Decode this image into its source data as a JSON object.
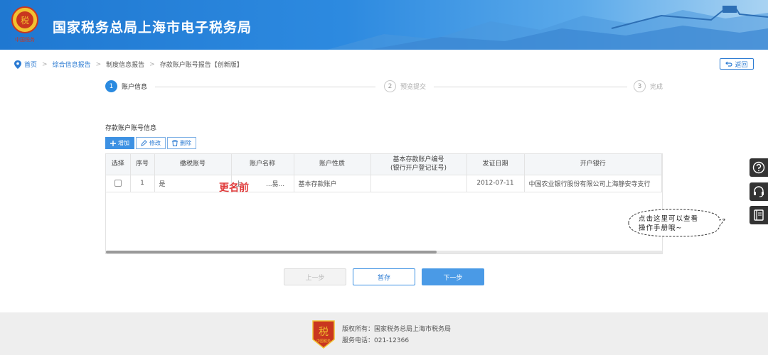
{
  "header": {
    "title": "国家税务总局上海市电子税务局",
    "logo_caption": "中国税务"
  },
  "breadcrumb": {
    "items": [
      "首页",
      "综合信息报告",
      "制度信息报告",
      "存款账户账号报告【创新版】"
    ]
  },
  "back_label": "返回",
  "steps": [
    {
      "num": "1",
      "label": "账户信息"
    },
    {
      "num": "2",
      "label": "预览提交"
    },
    {
      "num": "3",
      "label": "完成"
    }
  ],
  "section_title": "存款账户账号信息",
  "toolbar": {
    "add": "增加",
    "edit": "修改",
    "delete": "删除"
  },
  "table": {
    "headers": [
      "选择",
      "序号",
      "缴税账号",
      "账户名称",
      "账户性质",
      "基本存款账户编号",
      "(银行开户登记证号)",
      "发证日期",
      "开户银行"
    ],
    "row": {
      "seq": "1",
      "tax_account": "是",
      "account_name": "上...",
      "account_name_tail": "...易...",
      "nature": "基本存款账户",
      "basic_no": "",
      "issue_date": "2012-07-11",
      "bank": "中国农业银行股份有限公司上海静安寺支行"
    }
  },
  "overlay_label": "更名前",
  "actions": {
    "prev": "上一步",
    "save": "暂存",
    "next": "下一步"
  },
  "footer": {
    "copyright": "版权所有：国家税务总局上海市税务局",
    "phone": "服务电话：021-12366",
    "badge_caption": "中国税务"
  },
  "help_bubble": {
    "line1": "点击这里可以查看",
    "line2": "操作手册哦~"
  },
  "colors": {
    "primary": "#2a8ae0",
    "header_start": "#1f78d1",
    "annotation_red": "#e03a3a"
  }
}
